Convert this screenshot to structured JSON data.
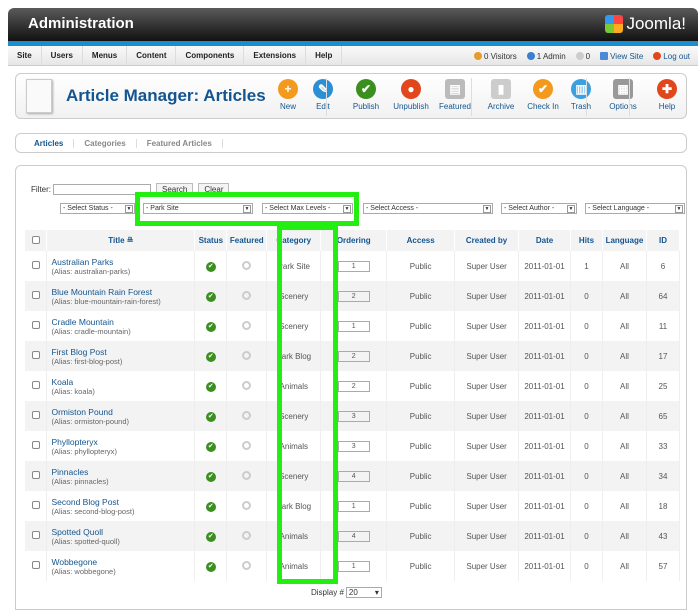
{
  "header": {
    "title": "Administration",
    "logo": "Joomla!"
  },
  "menu": [
    "Site",
    "Users",
    "Menus",
    "Content",
    "Components",
    "Extensions",
    "Help"
  ],
  "status": {
    "visitors": "0 Visitors",
    "admin": "1 Admin",
    "messages": "0",
    "view_site": "View Site",
    "logout": "Log out"
  },
  "toolbar": {
    "title": "Article Manager: Articles",
    "buttons": [
      {
        "label": "New",
        "icon": "plus-icon",
        "color": "#f39a1e"
      },
      {
        "label": "Edit",
        "icon": "pencil-icon",
        "color": "#2b8fd6"
      },
      {
        "label": "Publish",
        "icon": "check-icon",
        "color": "#3a8f1f"
      },
      {
        "label": "Unpublish",
        "icon": "stop-icon",
        "color": "#e2461c"
      },
      {
        "label": "Featured",
        "icon": "featured-icon",
        "color": "#bbbbbb"
      },
      {
        "label": "Archive",
        "icon": "archive-icon",
        "color": "#cccccc"
      },
      {
        "label": "Check In",
        "icon": "checkin-icon",
        "color": "#f39a1e"
      },
      {
        "label": "Trash",
        "icon": "trash-icon",
        "color": "#3aa0e0"
      },
      {
        "label": "Options",
        "icon": "options-icon",
        "color": "#999999"
      },
      {
        "label": "Help",
        "icon": "help-icon",
        "color": "#e2461c"
      }
    ]
  },
  "tabs": [
    {
      "label": "Articles",
      "active": true
    },
    {
      "label": "Categories"
    },
    {
      "label": "Featured Articles"
    }
  ],
  "filter": {
    "label": "Filter:",
    "value": "",
    "search": "Search",
    "clear": "Clear",
    "selects": [
      "- Select Status -",
      "- Park Site",
      "- Select Max Levels -",
      "- Select Access -",
      "- Select Author -",
      "- Select Language -"
    ]
  },
  "columns": [
    "Title",
    "Status",
    "Featured",
    "Category",
    "Ordering",
    "Access",
    "Created by",
    "Date",
    "Hits",
    "Language",
    "ID"
  ],
  "rows": [
    {
      "title": "Australian Parks",
      "alias": "australian-parks",
      "category": "Park Site",
      "ordering": "1",
      "access": "Public",
      "author": "Super User",
      "date": "2011-01-01",
      "hits": "1",
      "language": "All",
      "id": "6"
    },
    {
      "title": "Blue Mountain Rain Forest",
      "alias": "blue-mountain-rain-forest",
      "category": "Scenery",
      "ordering": "2",
      "access": "Public",
      "author": "Super User",
      "date": "2011-01-01",
      "hits": "0",
      "language": "All",
      "id": "64"
    },
    {
      "title": "Cradle Mountain",
      "alias": "cradle-mountain",
      "category": "Scenery",
      "ordering": "1",
      "access": "Public",
      "author": "Super User",
      "date": "2011-01-01",
      "hits": "0",
      "language": "All",
      "id": "11"
    },
    {
      "title": "First Blog Post",
      "alias": "first-blog-post",
      "category": "Park Blog",
      "ordering": "2",
      "access": "Public",
      "author": "Super User",
      "date": "2011-01-01",
      "hits": "0",
      "language": "All",
      "id": "17"
    },
    {
      "title": "Koala",
      "alias": "koala",
      "category": "Animals",
      "ordering": "2",
      "access": "Public",
      "author": "Super User",
      "date": "2011-01-01",
      "hits": "0",
      "language": "All",
      "id": "25"
    },
    {
      "title": "Ormiston Pound",
      "alias": "ormiston-pound",
      "category": "Scenery",
      "ordering": "3",
      "access": "Public",
      "author": "Super User",
      "date": "2011-01-01",
      "hits": "0",
      "language": "All",
      "id": "65"
    },
    {
      "title": "Phyllopteryx",
      "alias": "phyllopteryx",
      "category": "Animals",
      "ordering": "3",
      "access": "Public",
      "author": "Super User",
      "date": "2011-01-01",
      "hits": "0",
      "language": "All",
      "id": "33"
    },
    {
      "title": "Pinnacles",
      "alias": "pinnacles",
      "category": "Scenery",
      "ordering": "4",
      "access": "Public",
      "author": "Super User",
      "date": "2011-01-01",
      "hits": "0",
      "language": "All",
      "id": "34"
    },
    {
      "title": "Second Blog Post",
      "alias": "second-blog-post",
      "category": "Park Blog",
      "ordering": "1",
      "access": "Public",
      "author": "Super User",
      "date": "2011-01-01",
      "hits": "0",
      "language": "All",
      "id": "18"
    },
    {
      "title": "Spotted Quoll",
      "alias": "spotted-quoll",
      "category": "Animals",
      "ordering": "4",
      "access": "Public",
      "author": "Super User",
      "date": "2011-01-01",
      "hits": "0",
      "language": "All",
      "id": "43"
    },
    {
      "title": "Wobbegone",
      "alias": "wobbegone",
      "category": "Animals",
      "ordering": "1",
      "access": "Public",
      "author": "Super User",
      "date": "2011-01-01",
      "hits": "0",
      "language": "All",
      "id": "57"
    }
  ],
  "alias_label": "Alias:",
  "footer": {
    "display_label": "Display #",
    "display_value": "20"
  },
  "highlight_color": "#22ee11"
}
